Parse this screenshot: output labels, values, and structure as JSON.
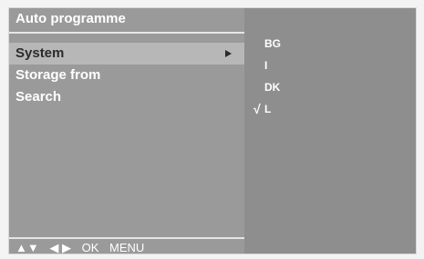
{
  "menu": {
    "title": "Auto programme",
    "items": [
      {
        "label": "System",
        "selected": true
      },
      {
        "label": "Storage from",
        "selected": false
      },
      {
        "label": "Search",
        "selected": false
      }
    ],
    "submenu_arrow_icon": "triangle-right-icon"
  },
  "options": {
    "items": [
      {
        "label": "BG",
        "checked": false
      },
      {
        "label": "I",
        "checked": false
      },
      {
        "label": "DK",
        "checked": false
      },
      {
        "label": "L",
        "checked": true
      }
    ],
    "check_mark": "√"
  },
  "footer": {
    "updown": "▲▼",
    "leftright": "◀ ▶",
    "ok": "OK",
    "menu": "MENU"
  },
  "colors": {
    "panel": "#9a9a9a",
    "highlight": "#b7b7b7",
    "text": "#ffffff"
  }
}
